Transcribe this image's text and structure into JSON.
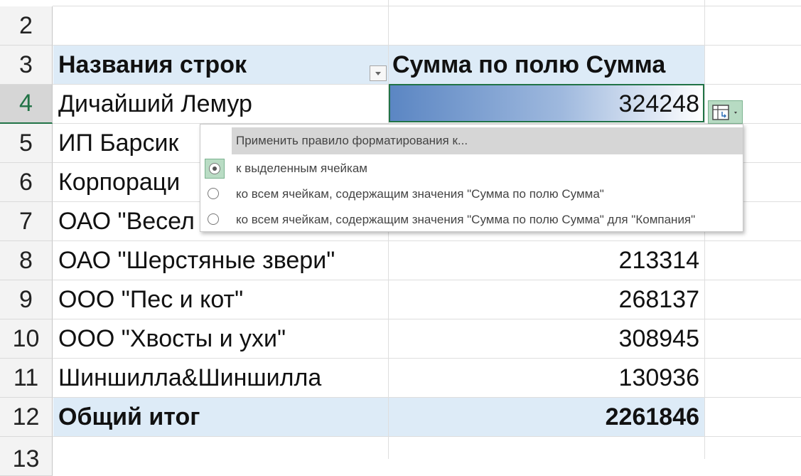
{
  "rows": [
    {
      "num": "2",
      "name": "",
      "value": ""
    },
    {
      "num": "3",
      "name": "Названия строк",
      "value": "Сумма по полю Сумма"
    },
    {
      "num": "4",
      "name": "Дичайший Лемур",
      "value": "324248"
    },
    {
      "num": "5",
      "name": "ИП Барсик",
      "value": ""
    },
    {
      "num": "6",
      "name": "Корпораци",
      "value": ""
    },
    {
      "num": "7",
      "name": "ОАО \"Весел",
      "value": ""
    },
    {
      "num": "8",
      "name": "ОАО \"Шерстяные звери\"",
      "value": "213314"
    },
    {
      "num": "9",
      "name": "ООО \"Пес и кот\"",
      "value": "268137"
    },
    {
      "num": "10",
      "name": "ООО \"Хвосты и ухи\"",
      "value": "308945"
    },
    {
      "num": "11",
      "name": "Шиншилла&Шиншилла",
      "value": "130936"
    },
    {
      "num": "12",
      "name": "Общий итог",
      "value": "2261846"
    },
    {
      "num": "13",
      "name": "",
      "value": ""
    }
  ],
  "popup": {
    "title": "Применить правило форматирования к...",
    "options": [
      {
        "label": "к выделенным ячейкам",
        "selected": true
      },
      {
        "label": "ко всем ячейкам, содержащим значения \"Сумма по полю Сумма\"",
        "selected": false
      },
      {
        "label": "ко всем ячейкам, содержащим значения \"Сумма по полю Сумма\" для \"Компания\"",
        "selected": false
      }
    ]
  },
  "icons": {
    "filter": "dropdown-filter-icon",
    "smarttag": "formatting-options-icon"
  },
  "colors": {
    "header_band": "#ddebf7",
    "selection": "#217346",
    "databar_start": "#5b86c3"
  }
}
